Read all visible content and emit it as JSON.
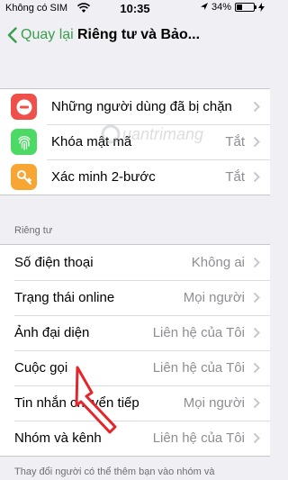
{
  "status_bar": {
    "carrier": "Không có SIM",
    "time": "10:35",
    "battery_percent": "34%",
    "battery_level": 0.34
  },
  "nav": {
    "back_label": "Quay lại",
    "title": "Riêng tư và Bảo..."
  },
  "security_items": [
    {
      "label": "Những người dùng đã bị chặn",
      "value": "",
      "icon": "minus-circle-icon",
      "color": "#f0504a"
    },
    {
      "label": "Khóa mật mã",
      "value": "Tắt",
      "icon": "fingerprint-icon",
      "color": "#4cd964"
    },
    {
      "label": "Xác minh 2-bước",
      "value": "Tắt",
      "icon": "key-icon",
      "color": "#f7a533"
    }
  ],
  "privacy_section": {
    "header": "Riêng tư",
    "items": [
      {
        "label": "Số điện thoại",
        "value": "Không ai"
      },
      {
        "label": "Trạng thái online",
        "value": "Mọi người"
      },
      {
        "label": "Ảnh đại diện",
        "value": "Liên hệ của Tôi"
      },
      {
        "label": "Cuộc gọi",
        "value": "Liên hệ của Tôi"
      },
      {
        "label": "Tin nhắn chuyển tiếp",
        "value": "Mọi người"
      },
      {
        "label": "Nhóm và kênh",
        "value": "Liên hệ của Tôi"
      }
    ],
    "footer": "Thay đổi người có thể thêm bạn vào nhóm và"
  },
  "watermark": {
    "text": "uantrimang"
  },
  "colors": {
    "accent": "#3a9e4c",
    "arrow": "#e3262b"
  }
}
